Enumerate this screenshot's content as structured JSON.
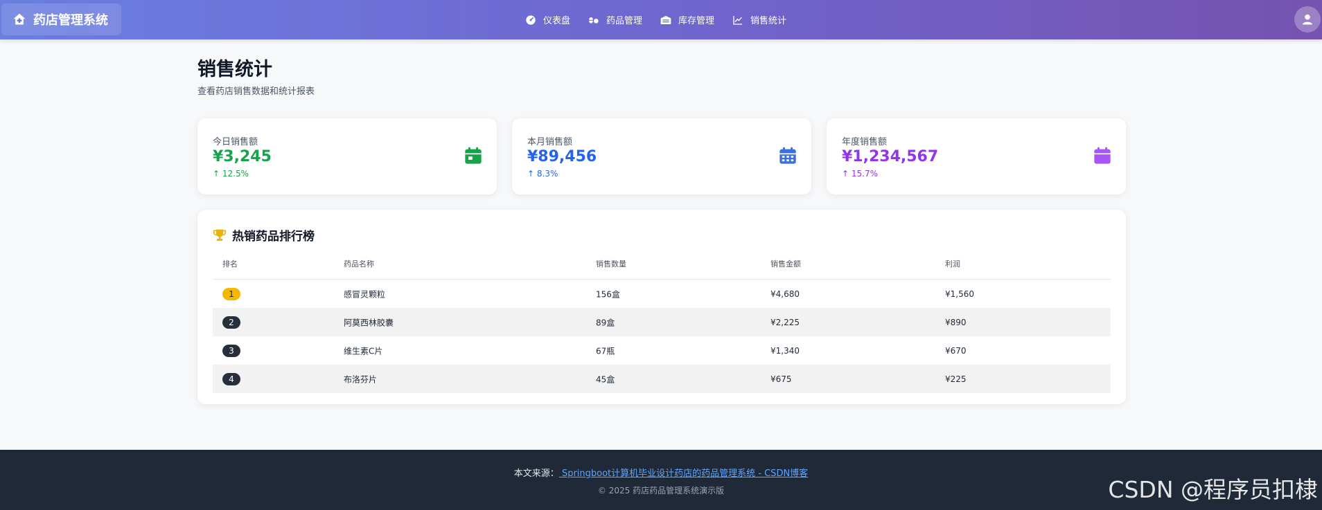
{
  "navbar": {
    "brand": "药店管理系统",
    "links": [
      {
        "label": "仪表盘",
        "icon": "dashboard-icon"
      },
      {
        "label": "药品管理",
        "icon": "pills-icon"
      },
      {
        "label": "库存管理",
        "icon": "warehouse-icon"
      },
      {
        "label": "销售统计",
        "icon": "chart-line-icon"
      }
    ]
  },
  "page": {
    "title": "销售统计",
    "subtitle": "查看药店销售数据和统计报表"
  },
  "stats": [
    {
      "label": "今日销售额",
      "value": "¥3,245",
      "change": "↑ 12.5%",
      "color": "#16a34a",
      "icon": "calendar-day-icon"
    },
    {
      "label": "本月销售额",
      "value": "¥89,456",
      "change": "↑ 8.3%",
      "color": "#2563eb",
      "icon": "calendar-month-icon"
    },
    {
      "label": "年度销售额",
      "value": "¥1,234,567",
      "change": "↑ 15.7%",
      "color": "#9333ea",
      "icon": "calendar-year-icon"
    }
  ],
  "ranking": {
    "title": "热销药品排行榜",
    "headers": [
      "排名",
      "药品名称",
      "销售数量",
      "销售金额",
      "利润"
    ],
    "rows": [
      {
        "rank": "1",
        "name": "感冒灵颗粒",
        "qty": "156盒",
        "amount": "¥4,680",
        "profit": "¥1,560"
      },
      {
        "rank": "2",
        "name": "阿莫西林胶囊",
        "qty": "89盒",
        "amount": "¥2,225",
        "profit": "¥890"
      },
      {
        "rank": "3",
        "name": "维生素C片",
        "qty": "67瓶",
        "amount": "¥1,340",
        "profit": "¥670"
      },
      {
        "rank": "4",
        "name": "布洛芬片",
        "qty": "45盒",
        "amount": "¥675",
        "profit": "¥225"
      }
    ]
  },
  "footer": {
    "source_prefix": "本文来源：",
    "source_link": " Springboot计算机毕业设计药店的药品管理系统 - CSDN博客",
    "copyright": "© 2025 药店药品管理系统演示版"
  },
  "watermark": "CSDN @程序员扣棣",
  "colors": {
    "nav_start": "#6a7fe0",
    "nav_end": "#7553b0",
    "gold_badge": "#f5b800",
    "dark_badge": "#272f3d",
    "trophy": "#eab308"
  }
}
